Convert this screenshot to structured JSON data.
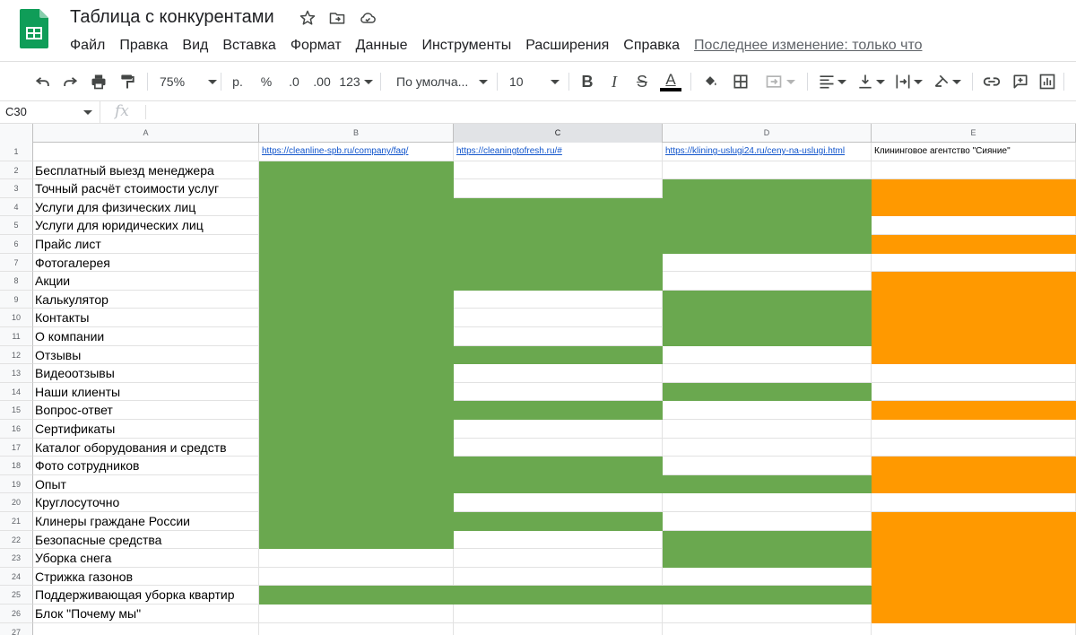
{
  "title": {
    "doc_name": "Таблица с конкурентами",
    "icons": [
      "star-icon",
      "move-to-folder-icon",
      "cloud-saved-icon"
    ]
  },
  "menu": {
    "items": [
      "Файл",
      "Правка",
      "Вид",
      "Вставка",
      "Формат",
      "Данные",
      "Инструменты",
      "Расширения",
      "Справка"
    ],
    "last_edit": "Последнее изменение: только что"
  },
  "toolbar": {
    "zoom": "75%",
    "currency": "р.",
    "percent": "%",
    "decrease_decimals": ".0",
    "increase_decimals": ".00",
    "more_formats": "123",
    "font": "По умолча...",
    "font_size": "10",
    "text_color": "#000000"
  },
  "formula_bar": {
    "cell_ref": "C30",
    "fx": "fx",
    "value": ""
  },
  "colors": {
    "green": "#6aa84f",
    "orange": "#ff9900",
    "link": "#1155cc"
  },
  "sheet": {
    "columns": [
      "A",
      "B",
      "C",
      "D",
      "E"
    ],
    "selected_column": "C",
    "header_row": {
      "A": "",
      "B": "https://cleanline-spb.ru/company/faq/",
      "C": "https://cleaningtofresh.ru/#",
      "D": "https://klining-uslugi24.ru/ceny-na-uslugi.html",
      "E": "Клининговое агентство \"Сияние\""
    },
    "rows": [
      {
        "n": "2",
        "label": "Бесплатный выезд менеджера",
        "fill": [
          "g",
          "",
          "",
          ""
        ]
      },
      {
        "n": "3",
        "label": "Точный расчёт стоимости услуг",
        "fill": [
          "g",
          "",
          "g",
          "o"
        ]
      },
      {
        "n": "4",
        "label": "Услуги для физических лиц",
        "fill": [
          "g",
          "g",
          "g",
          "o"
        ]
      },
      {
        "n": "5",
        "label": "Услуги для юридических лиц",
        "fill": [
          "g",
          "g",
          "g",
          ""
        ]
      },
      {
        "n": "6",
        "label": "Прайс лист",
        "fill": [
          "g",
          "g",
          "g",
          "o"
        ]
      },
      {
        "n": "7",
        "label": "Фотогалерея",
        "fill": [
          "g",
          "g",
          "",
          ""
        ]
      },
      {
        "n": "8",
        "label": "Акции",
        "fill": [
          "g",
          "g",
          "",
          "o"
        ]
      },
      {
        "n": "9",
        "label": "Калькулятор",
        "fill": [
          "g",
          "",
          "g",
          "o"
        ]
      },
      {
        "n": "10",
        "label": "Контакты",
        "fill": [
          "g",
          "",
          "g",
          "o"
        ]
      },
      {
        "n": "11",
        "label": "О компании",
        "fill": [
          "g",
          "",
          "g",
          "o"
        ]
      },
      {
        "n": "12",
        "label": "Отзывы",
        "fill": [
          "g",
          "g",
          "",
          "o"
        ]
      },
      {
        "n": "13",
        "label": "Видеоотзывы",
        "fill": [
          "g",
          "",
          "",
          ""
        ]
      },
      {
        "n": "14",
        "label": "Наши клиенты",
        "fill": [
          "g",
          "",
          "g",
          ""
        ]
      },
      {
        "n": "15",
        "label": "Вопрос-ответ",
        "fill": [
          "g",
          "g",
          "",
          "o"
        ]
      },
      {
        "n": "16",
        "label": "Сертификаты",
        "fill": [
          "g",
          "",
          "",
          ""
        ]
      },
      {
        "n": "17",
        "label": "Каталог оборудования и средств",
        "fill": [
          "g",
          "",
          "",
          ""
        ]
      },
      {
        "n": "18",
        "label": "Фото сотрудников",
        "fill": [
          "g",
          "g",
          "",
          "o"
        ]
      },
      {
        "n": "19",
        "label": "Опыт",
        "fill": [
          "g",
          "g",
          "g",
          "o"
        ]
      },
      {
        "n": "20",
        "label": "Круглосуточно",
        "fill": [
          "g",
          "",
          "",
          ""
        ]
      },
      {
        "n": "21",
        "label": "Клинеры граждане России",
        "fill": [
          "g",
          "g",
          "",
          "o"
        ]
      },
      {
        "n": "22",
        "label": "Безопасные средства",
        "fill": [
          "g",
          "",
          "g",
          "o"
        ]
      },
      {
        "n": "23",
        "label": "Уборка снега",
        "fill": [
          "",
          "",
          "g",
          "o"
        ]
      },
      {
        "n": "24",
        "label": "Стрижка газонов",
        "fill": [
          "",
          "",
          "",
          "o"
        ]
      },
      {
        "n": "25",
        "label": "Поддерживающая уборка квартир",
        "fill": [
          "g",
          "g",
          "g",
          "o"
        ]
      },
      {
        "n": "26",
        "label": "Блок \"Почему мы\"",
        "fill": [
          "",
          "",
          "",
          "o"
        ]
      },
      {
        "n": "27",
        "label": "",
        "fill": [
          "",
          "",
          "",
          ""
        ]
      }
    ]
  }
}
